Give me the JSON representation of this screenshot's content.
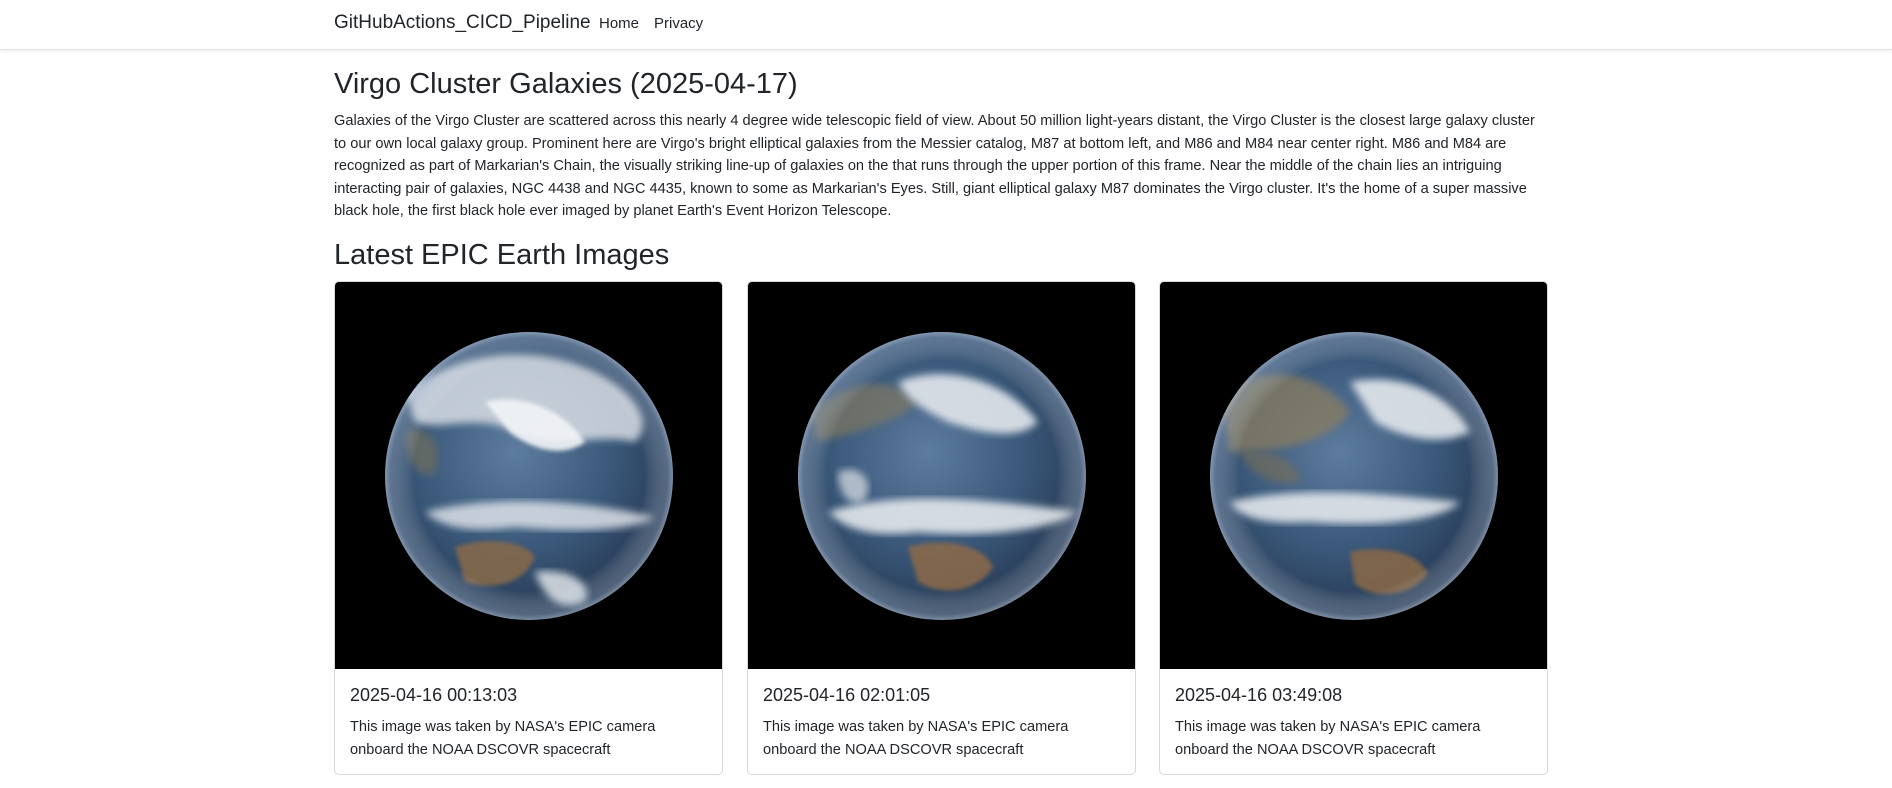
{
  "nav": {
    "brand": "GitHubActions_CICD_Pipeline",
    "links": [
      "Home",
      "Privacy"
    ]
  },
  "apod": {
    "title": "Virgo Cluster Galaxies (2025-04-17)",
    "explanation": "Galaxies of the Virgo Cluster are scattered across this nearly 4 degree wide telescopic field of view. About 50 million light-years distant, the Virgo Cluster is the closest large galaxy cluster to our own local galaxy group. Prominent here are Virgo's bright elliptical galaxies from the Messier catalog, M87 at bottom left, and M86 and M84 near center right. M86 and M84 are recognized as part of Markarian's Chain, the visually striking line-up of galaxies on the that runs through the upper portion of this frame. Near the middle of the chain lies an intriguing interacting pair of galaxies, NGC 4438 and NGC 4435, known to some as Markarian's Eyes. Still, giant elliptical galaxy M87 dominates the Virgo cluster. It's the home of a super massive black hole, the first black hole ever imaged by planet Earth's Event Horizon Telescope."
  },
  "epic": {
    "heading": "Latest EPIC Earth Images",
    "images": [
      {
        "timestamp": "2025-04-16 00:13:03",
        "caption": "This image was taken by NASA's EPIC camera onboard the NOAA DSCOVR spacecraft"
      },
      {
        "timestamp": "2025-04-16 02:01:05",
        "caption": "This image was taken by NASA's EPIC camera onboard the NOAA DSCOVR spacecraft"
      },
      {
        "timestamp": "2025-04-16 03:49:08",
        "caption": "This image was taken by NASA's EPIC camera onboard the NOAA DSCOVR spacecraft"
      }
    ]
  },
  "colors": {
    "text": "#212529",
    "border": "#dee2e6",
    "image_background": "#000000"
  }
}
